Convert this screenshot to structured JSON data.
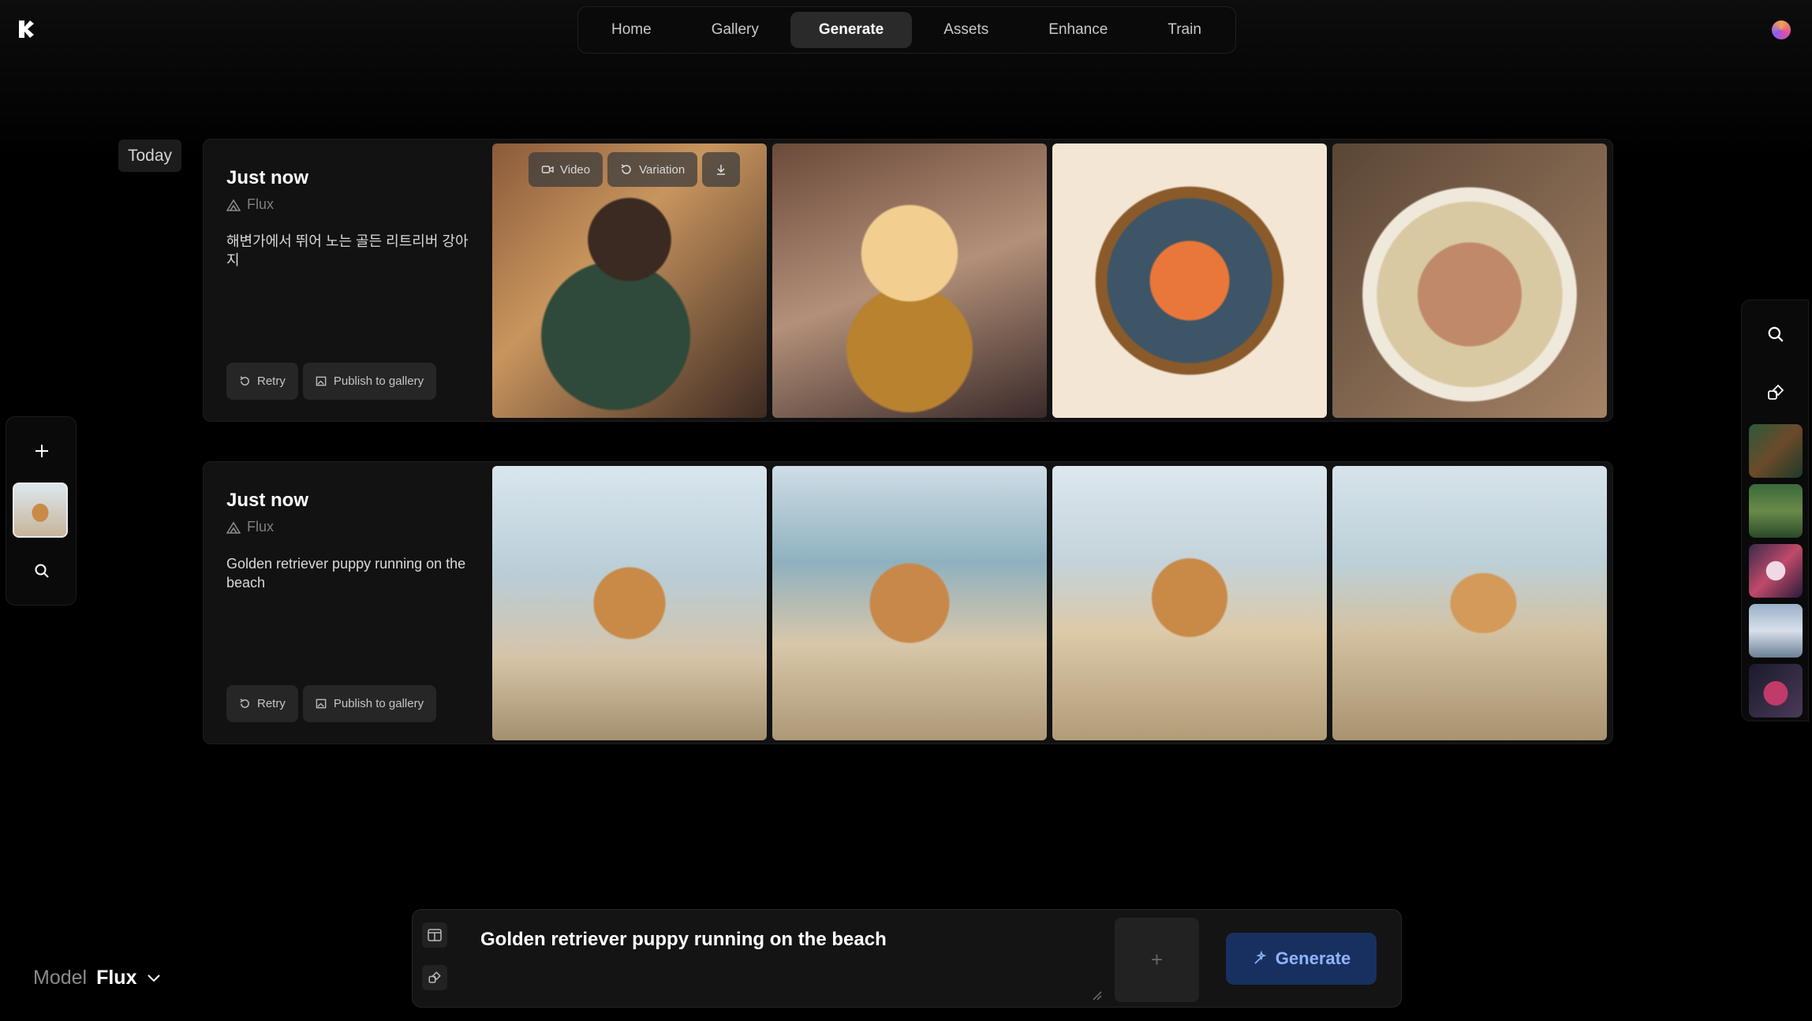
{
  "nav": {
    "items": [
      {
        "label": "Home",
        "active": false
      },
      {
        "label": "Gallery",
        "active": false
      },
      {
        "label": "Generate",
        "active": true
      },
      {
        "label": "Assets",
        "active": false
      },
      {
        "label": "Enhance",
        "active": false
      },
      {
        "label": "Train",
        "active": false
      }
    ]
  },
  "section_label": "Today",
  "generations": [
    {
      "time": "Just now",
      "model": "Flux",
      "prompt": "해변가에서 뛰어 노는 골든 리트리버 강아지",
      "retry_label": "Retry",
      "publish_label": "Publish to gallery",
      "overlay": {
        "video_label": "Video",
        "variation_label": "Variation"
      },
      "images": [
        "anime-girl-drinking",
        "anime-girl-festival",
        "salmon-plate-illustration",
        "dumpling-soup"
      ]
    },
    {
      "time": "Just now",
      "model": "Flux",
      "prompt": "Golden retriever puppy running on the beach",
      "retry_label": "Retry",
      "publish_label": "Publish to gallery",
      "images": [
        "puppy-beach-1",
        "puppy-beach-2",
        "puppy-beach-3",
        "puppy-beach-4"
      ]
    }
  ],
  "model_selector": {
    "label": "Model",
    "value": "Flux"
  },
  "prompt_bar": {
    "text": "Golden retriever puppy running on the beach",
    "generate_label": "Generate"
  },
  "colors": {
    "accent": "#18305f",
    "accent_text": "#8fb4ff",
    "background": "#000000"
  }
}
